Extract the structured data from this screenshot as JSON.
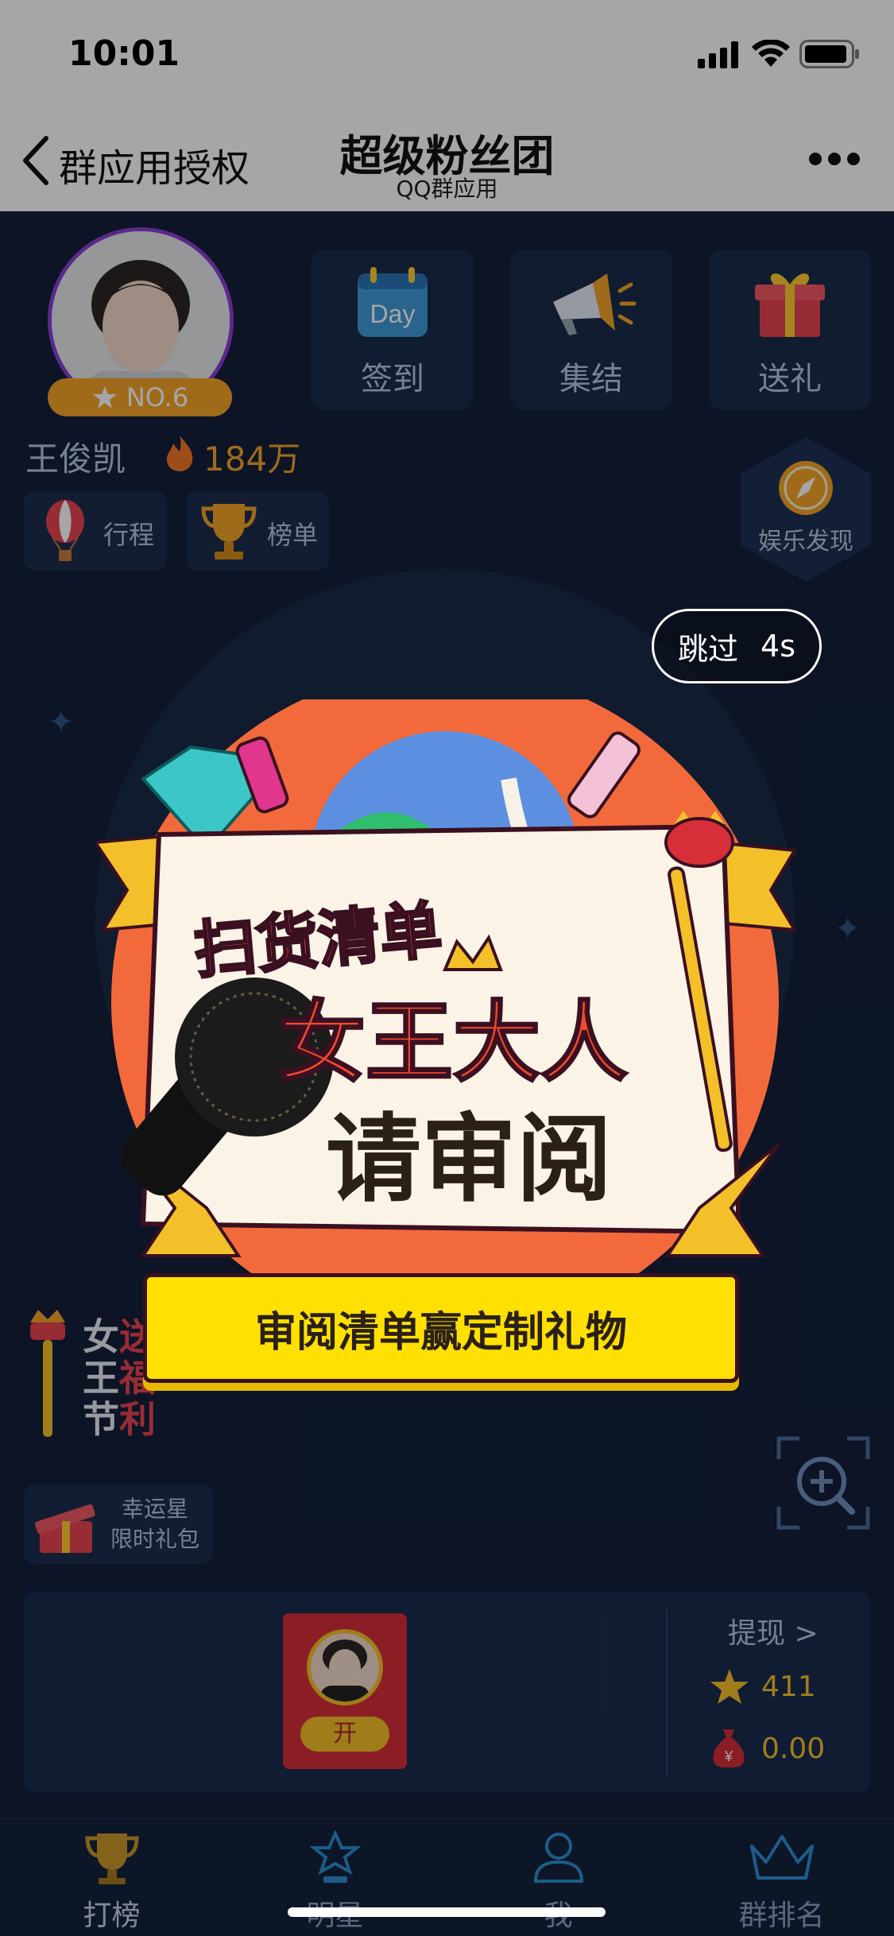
{
  "status_bar": {
    "time": "10:01"
  },
  "nav": {
    "back_label": "群应用授权",
    "title": "超级粉丝团",
    "subtitle": "QQ群应用"
  },
  "profile": {
    "rank": "NO.6",
    "name": "王俊凯",
    "heat": "184万"
  },
  "actions": [
    {
      "label": "签到",
      "icon_text": "Day"
    },
    {
      "label": "集结"
    },
    {
      "label": "送礼"
    }
  ],
  "chips": {
    "schedule": "行程",
    "ranking": "榜单"
  },
  "discover": {
    "label": "娱乐发现"
  },
  "ad": {
    "skip_label": "跳过",
    "skip_countdown": "4s",
    "headline": "扫货清单",
    "line2": "女王大人",
    "line3": "请审阅",
    "cta": "审阅清单赢定制礼物"
  },
  "festival": {
    "chars": [
      "女",
      "王",
      "节"
    ],
    "chars2": [
      "送",
      "福",
      "利"
    ]
  },
  "lucky": {
    "line1": "幸运星",
    "line2": "限时礼包"
  },
  "wallet": {
    "open_label": "开",
    "withdraw": "提现 >",
    "stars": "411",
    "money": "0.00"
  },
  "tabs": [
    {
      "label": "打榜"
    },
    {
      "label": "明星"
    },
    {
      "label": "我"
    },
    {
      "label": "群排名"
    }
  ],
  "colors": {
    "bg": "#13203a",
    "accent": "#f4a52a",
    "ad_orange": "#f26a3c",
    "cta_yellow": "#ffe000"
  }
}
